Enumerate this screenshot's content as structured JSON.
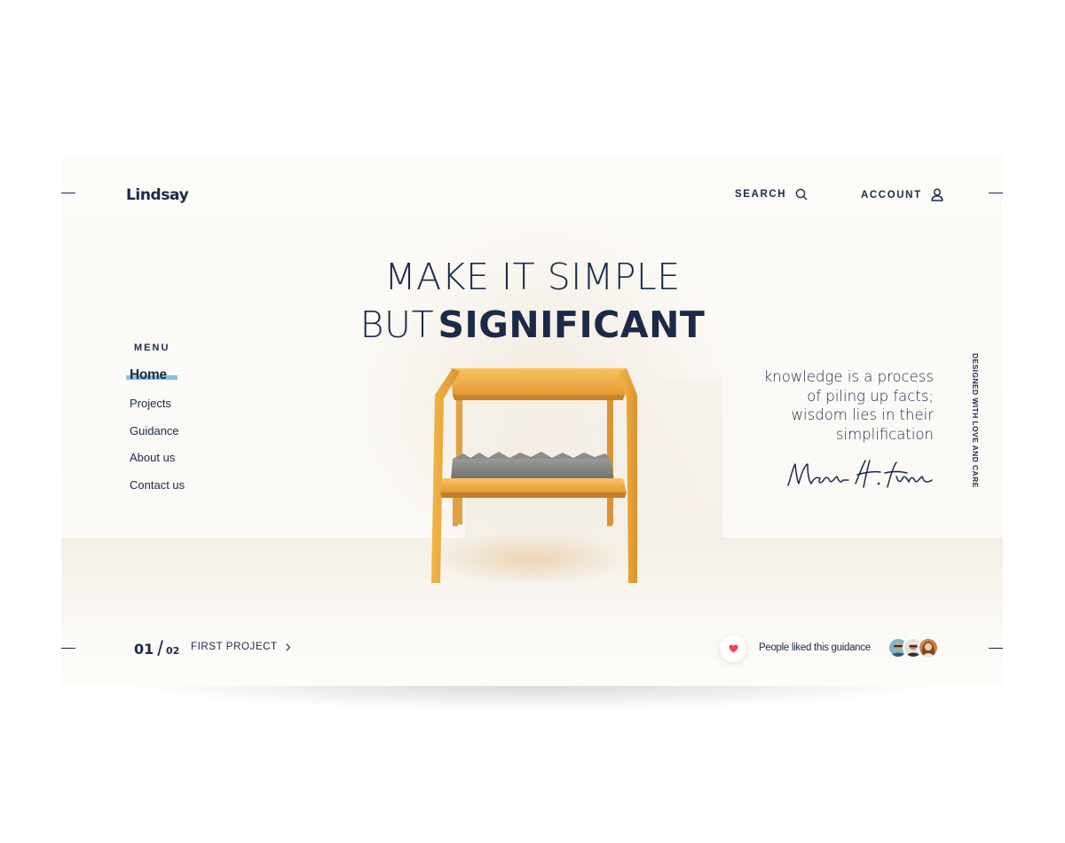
{
  "brand": {
    "logo": "Lindsay"
  },
  "topnav": {
    "search_label": "SEARCH",
    "search_icon": "search-icon",
    "account_label": "ACCOUNT",
    "account_icon": "user-icon"
  },
  "hero": {
    "line1": "MAKE IT SIMPLE",
    "line2_light": "BUT",
    "line2_bold": "SIGNIFICANT"
  },
  "menu": {
    "title": "MENU",
    "items": [
      {
        "label": "Home",
        "active": true
      },
      {
        "label": "Projects"
      },
      {
        "label": "Guidance"
      },
      {
        "label": "About us"
      },
      {
        "label": "Contact us"
      }
    ]
  },
  "quote": {
    "lines": [
      "knowledge is a process",
      "of piling up facts;",
      "wisdom lies in their",
      "simplification"
    ],
    "signature": "Martin H. Fischer"
  },
  "vertical_text": "DESIGNED WITH LOVE AND CARE",
  "pager": {
    "current": "01",
    "separator": "/",
    "total": "02",
    "next_label": "FIRST PROJECT",
    "next_icon": "chevron-right-icon"
  },
  "likes": {
    "label": "People liked this guidance",
    "icon": "heart-icon"
  },
  "colors": {
    "navy": "#1b2a47",
    "accent": "#82c4e3",
    "heart": "#e8485b",
    "wood": "#e6a23c"
  }
}
